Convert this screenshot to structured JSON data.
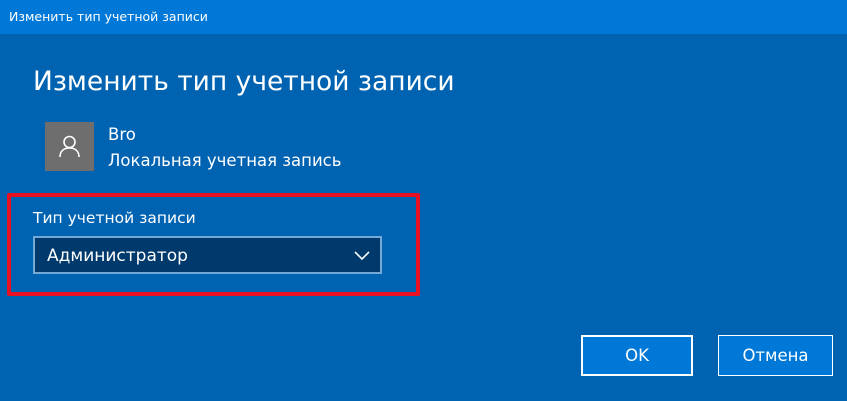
{
  "window": {
    "title": "Изменить тип учетной записи"
  },
  "dialog": {
    "heading": "Изменить тип учетной записи"
  },
  "user": {
    "avatar_icon": "user-icon",
    "name": "Bro",
    "account_kind": "Локальная учетная запись"
  },
  "account_type": {
    "label": "Тип учетной записи",
    "selected": "Администратор",
    "dropdown_icon": "chevron-down-icon"
  },
  "buttons": {
    "ok": "OK",
    "cancel": "Отмена"
  },
  "colors": {
    "background": "#0063b1",
    "titlebar": "#0078d7",
    "select_background": "#003a6c",
    "select_border": "#74a9d6",
    "highlight": "#e81123",
    "avatar": "#6e6e6e",
    "button": "#0078d7"
  }
}
